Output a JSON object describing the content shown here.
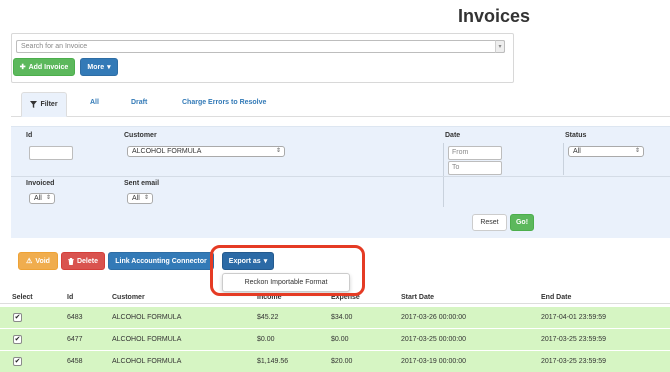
{
  "page_title": "Invoices",
  "search": {
    "placeholder": "Search for an Invoice"
  },
  "buttons": {
    "add_invoice": "Add Invoice",
    "more": "More",
    "void": "Void",
    "delete": "Delete",
    "link_accounting": "Link Accounting Connector",
    "export_as": "Export as",
    "reset": "Reset",
    "go": "Go!"
  },
  "tabs": {
    "filter": "Filter",
    "all": "All",
    "draft": "Draft",
    "charge_errors": "Charge Errors to Resolve"
  },
  "filter": {
    "id_label": "Id",
    "customer_label": "Customer",
    "customer_value": "ALCOHOL FORMULA",
    "date_label": "Date",
    "date_from_placeholder": "From",
    "date_to_placeholder": "To",
    "status_label": "Status",
    "status_value": "All",
    "invoiced_label": "Invoiced",
    "invoiced_value": "All",
    "sent_email_label": "Sent email",
    "sent_email_value": "All"
  },
  "export_menu": {
    "items": [
      "Reckon Importable Format"
    ]
  },
  "table": {
    "headers": [
      "Select",
      "Id",
      "Customer",
      "Income",
      "Expense",
      "Start Date",
      "End Date"
    ],
    "rows": [
      {
        "selected": true,
        "id": "6483",
        "customer": "ALCOHOL FORMULA",
        "income": "$45.22",
        "expense": "$34.00",
        "start": "2017-03-26 00:00:00",
        "end": "2017-04-01 23:59:59"
      },
      {
        "selected": true,
        "id": "6477",
        "customer": "ALCOHOL FORMULA",
        "income": "$0.00",
        "expense": "$0.00",
        "start": "2017-03-25 00:00:00",
        "end": "2017-03-25 23:59:59"
      },
      {
        "selected": true,
        "id": "6458",
        "customer": "ALCOHOL FORMULA",
        "income": "$1,149.56",
        "expense": "$20.00",
        "start": "2017-03-19 00:00:00",
        "end": "2017-03-25 23:59:59"
      }
    ]
  },
  "colors": {
    "primary": "#337ab7",
    "success": "#5cb85c",
    "warning": "#f0ad4e",
    "danger": "#d9534f",
    "row_selected": "#d6f5c3",
    "highlight": "#e53b24"
  },
  "icons": {
    "add": "plus-icon",
    "filter": "funnel-icon",
    "void": "warning-icon",
    "delete": "trash-icon",
    "caret": "caret-down-icon"
  }
}
